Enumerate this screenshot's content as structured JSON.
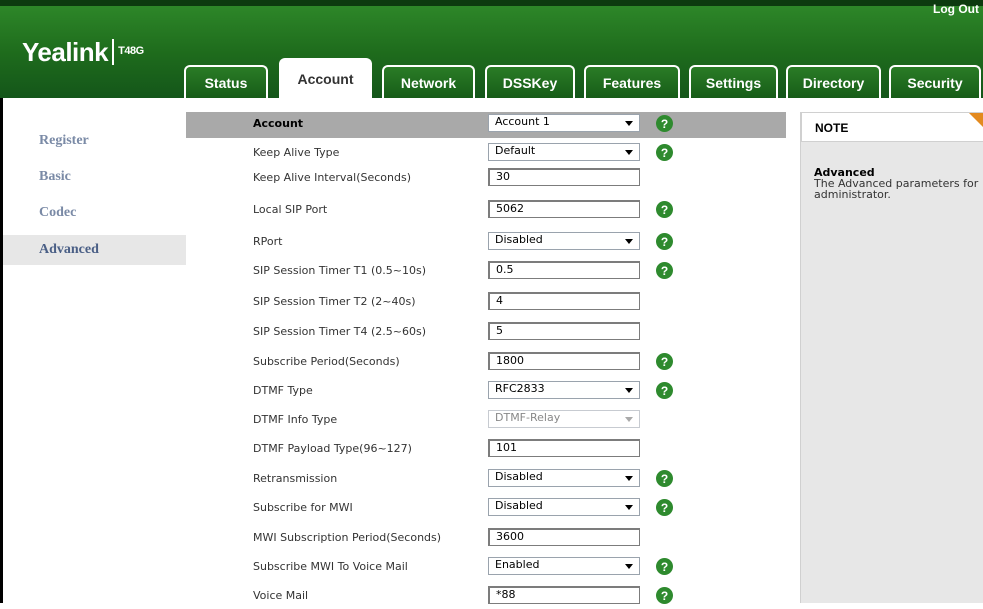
{
  "header": {
    "logo": "Yealink",
    "model": "T48G",
    "logout": "Log Out"
  },
  "tabs": [
    {
      "label": "Status"
    },
    {
      "label": "Account"
    },
    {
      "label": "Network"
    },
    {
      "label": "DSSKey"
    },
    {
      "label": "Features"
    },
    {
      "label": "Settings"
    },
    {
      "label": "Directory"
    },
    {
      "label": "Security"
    }
  ],
  "active_tab": "Account",
  "sidebar": {
    "items": [
      {
        "label": "Register"
      },
      {
        "label": "Basic"
      },
      {
        "label": "Codec"
      },
      {
        "label": "Advanced"
      }
    ],
    "active": "Advanced"
  },
  "form": {
    "header": {
      "label": "Account",
      "value": "Account 1"
    },
    "rows": [
      {
        "label": "Keep Alive Type",
        "value": "Default"
      },
      {
        "label": "Keep Alive Interval(Seconds)",
        "value": "30"
      },
      {
        "label": "Local SIP Port",
        "value": "5062"
      },
      {
        "label": "RPort",
        "value": "Disabled"
      },
      {
        "label": "SIP Session Timer T1 (0.5~10s)",
        "value": "0.5"
      },
      {
        "label": "SIP Session Timer T2 (2~40s)",
        "value": "4"
      },
      {
        "label": "SIP Session Timer T4 (2.5~60s)",
        "value": "5"
      },
      {
        "label": "Subscribe Period(Seconds)",
        "value": "1800"
      },
      {
        "label": "DTMF Type",
        "value": "RFC2833"
      },
      {
        "label": "DTMF Info Type",
        "value": "DTMF-Relay"
      },
      {
        "label": "DTMF Payload Type(96~127)",
        "value": "101"
      },
      {
        "label": "Retransmission",
        "value": "Disabled"
      },
      {
        "label": "Subscribe for MWI",
        "value": "Disabled"
      },
      {
        "label": "MWI Subscription Period(Seconds)",
        "value": "3600"
      },
      {
        "label": "Subscribe MWI To Voice Mail",
        "value": "Enabled"
      },
      {
        "label": "Voice Mail",
        "value": "*88"
      }
    ]
  },
  "note": {
    "title": "NOTE",
    "heading": "Advanced",
    "text": "The Advanced parameters for administrator."
  },
  "help_glyph": "?",
  "colors": {
    "brand_green": "#1e6b1c",
    "help_green": "#2e8a2e",
    "header_gray": "#a9a9a9",
    "note_accent": "#e38a1f"
  }
}
